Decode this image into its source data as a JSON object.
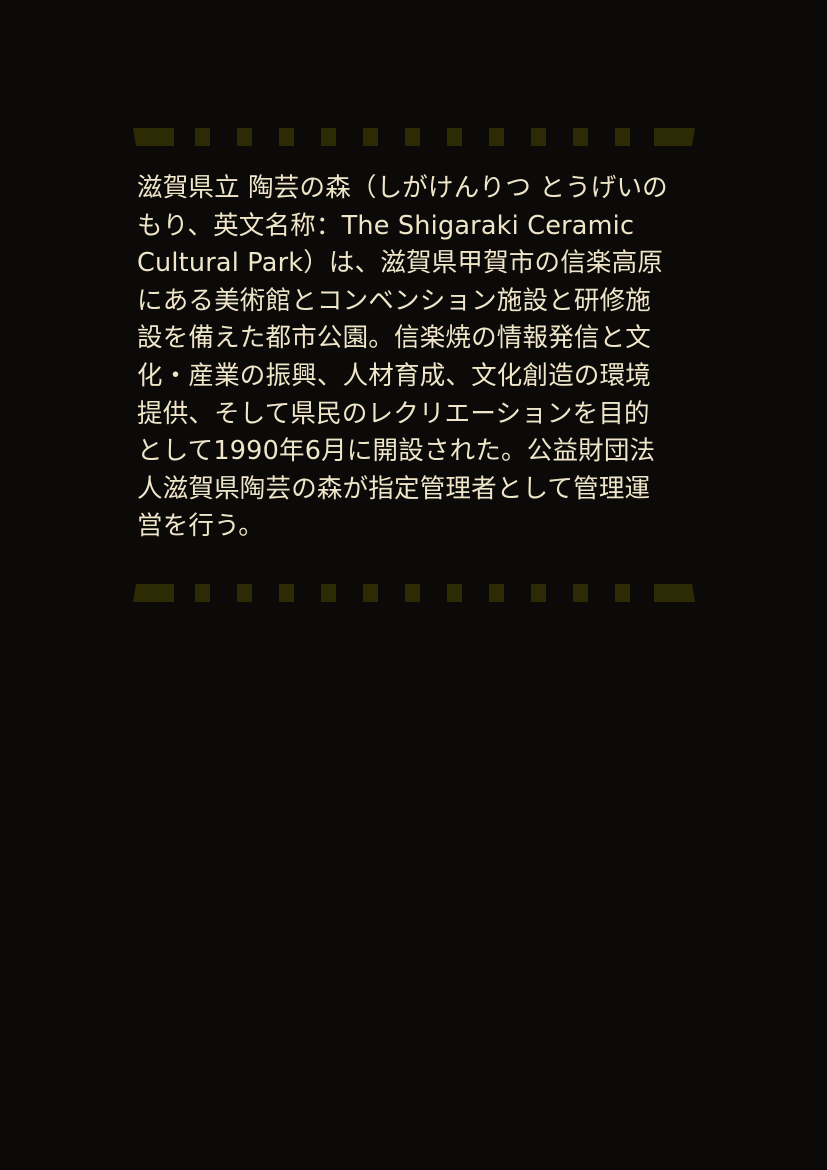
{
  "article": {
    "lines": [
      "滋賀県立 陶芸の森（しがけんりつ とうげいの",
      "もり、英文名称：The Shigaraki Ceramic",
      "Cultural Park）は、滋賀県甲賀市の信楽高原",
      "にある美術館とコンベンション施設と研修施",
      "設を備えた都市公園。信楽焼の情報発信と文",
      "化・産業の振興、人材育成、文化創造の環境",
      "提供、そして県民のレクリエーションを目的",
      "として1990年6月に開設された。公益財団法",
      "人滋賀県陶芸の森が指定管理者として管理運",
      "営を行う。"
    ]
  },
  "colors": {
    "background": "#0b0a08",
    "text": "#efe6c9",
    "border_dash": "#2c2b04"
  }
}
